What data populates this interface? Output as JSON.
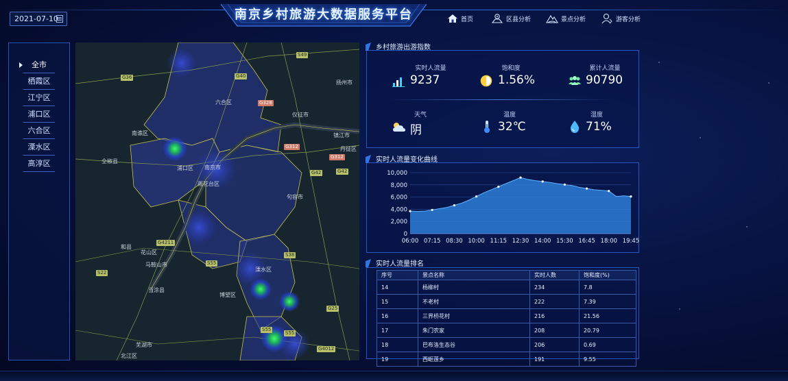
{
  "header": {
    "title": "南京乡村旅游大数据服务平台",
    "date": "2021-07-10",
    "nav": [
      {
        "label": "首页",
        "icon": "home-icon"
      },
      {
        "label": "区县分析",
        "icon": "map-pin-icon"
      },
      {
        "label": "景点分析",
        "icon": "mountain-icon"
      },
      {
        "label": "游客分析",
        "icon": "user-icon"
      }
    ]
  },
  "sidebar": {
    "items": [
      "全市",
      "栖霞区",
      "江宁区",
      "浦口区",
      "六合区",
      "溧水区",
      "高淳区"
    ],
    "active": "全市"
  },
  "map": {
    "labels": [
      {
        "text": "六合区"
      },
      {
        "text": "仪征市"
      },
      {
        "text": "南谯区"
      },
      {
        "text": "全椒县"
      },
      {
        "text": "浦口区"
      },
      {
        "text": "南京市"
      },
      {
        "text": "雨花台区"
      },
      {
        "text": "镇江市"
      },
      {
        "text": "句容市"
      },
      {
        "text": "扬州市"
      },
      {
        "text": "丹徒区"
      },
      {
        "text": "和县"
      },
      {
        "text": "花山区"
      },
      {
        "text": "马鞍山市"
      },
      {
        "text": "溧水区"
      },
      {
        "text": "当涂县"
      },
      {
        "text": "博望区"
      },
      {
        "text": "芜湖市"
      },
      {
        "text": "北江区"
      }
    ],
    "roads": [
      "G36",
      "G40",
      "S49",
      "G328",
      "G312",
      "G312",
      "G42",
      "G42",
      "G4211",
      "S22",
      "S38",
      "S55",
      "G25",
      "S55",
      "G4012",
      "S55"
    ]
  },
  "realtime_panel": {
    "title": "乡村旅游出游指数",
    "metrics": [
      {
        "label": "实时人流量",
        "value": "9237",
        "icon": "bar-chart-icon"
      },
      {
        "label": "饱和度",
        "value": "1.56%",
        "icon": "half-circle-icon"
      },
      {
        "label": "累计人流量",
        "value": "90790",
        "icon": "group-icon"
      },
      {
        "label": "天气",
        "value": "阴",
        "icon": "cloudy-icon"
      },
      {
        "label": "温度",
        "value": "32℃",
        "icon": "thermometer-icon"
      },
      {
        "label": "湿度",
        "value": "71%",
        "icon": "droplet-icon"
      }
    ]
  },
  "flow_panel": {
    "title": "实时人流量变化曲线"
  },
  "chart_data": {
    "type": "area",
    "x": [
      "06:00",
      "06:30",
      "07:00",
      "07:15",
      "07:30",
      "08:00",
      "08:30",
      "09:00",
      "09:30",
      "10:00",
      "10:30",
      "11:00",
      "11:15",
      "11:30",
      "12:00",
      "12:30",
      "13:00",
      "13:30",
      "14:00",
      "14:30",
      "15:00",
      "15:30",
      "16:00",
      "16:30",
      "16:45",
      "17:00",
      "17:30",
      "18:00",
      "18:30",
      "19:00",
      "19:45"
    ],
    "values": [
      3700,
      3650,
      3700,
      3900,
      4100,
      4300,
      4650,
      5000,
      5500,
      6100,
      6700,
      7200,
      7700,
      8200,
      8700,
      9200,
      8900,
      8700,
      8550,
      8400,
      8200,
      8050,
      7900,
      7600,
      7400,
      7200,
      7100,
      7000,
      6100,
      6200,
      6100
    ],
    "xticks": [
      "06:00",
      "07:15",
      "08:30",
      "10:00",
      "11:15",
      "12:30",
      "14:00",
      "15:30",
      "16:45",
      "18:00",
      "19:45"
    ],
    "yticks": [
      "0",
      "2,000",
      "4,000",
      "6,000",
      "8,000",
      "10,000"
    ],
    "ylim": [
      0,
      10000
    ],
    "color": "#2d7ed8",
    "grid": true
  },
  "rank_panel": {
    "title": "实时人流量排名",
    "columns": [
      "序号",
      "景点名称",
      "实时人数",
      "饱和度(%)"
    ],
    "rows": [
      [
        "14",
        "杨柳村",
        "234",
        "7.8"
      ],
      [
        "15",
        "不老村",
        "222",
        "7.39"
      ],
      [
        "16",
        "三界桥花村",
        "216",
        "21.56"
      ],
      [
        "17",
        "朱门农家",
        "208",
        "20.79"
      ],
      [
        "18",
        "巴布洛生态谷",
        "206",
        "0.69"
      ],
      [
        "19",
        "西岖莲乡",
        "191",
        "9.55"
      ]
    ]
  },
  "colors": {
    "accent": "#2f6bd8",
    "panel_border": "#2657c2",
    "area_fill": "#2d7ed8"
  }
}
